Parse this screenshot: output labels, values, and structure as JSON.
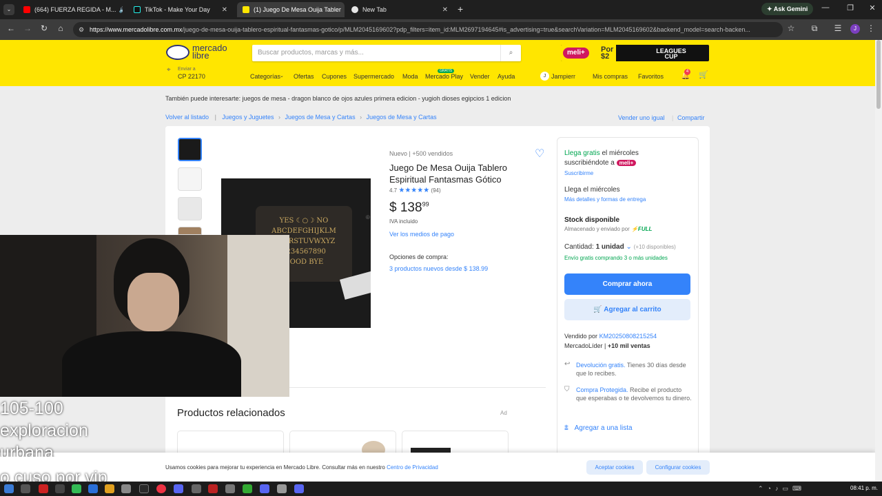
{
  "browser": {
    "tabs": [
      {
        "label": "(664) FUERZA REGIDA - M...",
        "color": "#ff0000"
      },
      {
        "label": "TikTok - Make Your Day",
        "color": "#111111"
      },
      {
        "label": "(1) Juego De Mesa Ouija Tabler",
        "color": "#ffe600"
      },
      {
        "label": "New Tab",
        "color": "#e6e6e6"
      }
    ],
    "ask_gemini": "Ask Gemini",
    "url_host": "https://www.mercadolibre.com.mx",
    "url_path": "/juego-de-mesa-ouija-tablero-espiritual-fantasmas-gotico/p/MLM2045169602?pdp_filters=item_id:MLM2697194645#is_advertising=true&searchVariation=MLM2045169602&backend_model=search-backen...",
    "profile_initial": "J"
  },
  "header": {
    "logo_line1": "mercado",
    "logo_line2": "libre",
    "search_placeholder": "Buscar productos, marcas y más...",
    "promo_badge": "meli+",
    "promo_text": "Por $2",
    "promo_leagues": "LEAGUES CUP",
    "ship_label": "Enviar a",
    "ship_cp": "CP 22170",
    "nav": [
      "Categorías",
      "Ofertas",
      "Cupones",
      "Supermercado",
      "Moda",
      "Mercado Play",
      "Vender",
      "Ayuda"
    ],
    "play_badge": "GRATIS",
    "user": "Jampierr",
    "user_initial": "J",
    "my_purchases": "Mis compras",
    "favorites": "Favoritos",
    "notif_count": "4"
  },
  "suggest": {
    "label": "También puede interesarte:",
    "items": "juegos de mesa - dragon blanco de ojos azules primera edicion - yugioh dioses egipcios 1 edicion"
  },
  "breadcrumb": {
    "back": "Volver al listado",
    "items": [
      "Juegos y Juguetes",
      "Juegos de Mesa y Cartas",
      "Juegos de Mesa y Cartas"
    ],
    "sell_same": "Vender uno igual",
    "share": "Compartir"
  },
  "product": {
    "condition": "Nuevo  |  +500 vendidos",
    "title": "Juego De Mesa Ouija Tablero Espiritual Fantasmas Gótico",
    "rating": "4.7",
    "stars": "★★★★★",
    "reviews": "(94)",
    "currency": "$",
    "price": "138",
    "cents": "99",
    "tax": "IVA incluido",
    "payment": "Ver los medios de pago",
    "options_label": "Opciones de compra:",
    "options_link": "3 productos nuevos desde $ 138.99",
    "board_text1": "YES",
    "board_text2": "NO",
    "board_row1": "OPQRSTUVWXYZ",
    "board_row2": "ABCDEFGHIJKLM",
    "board_row3": "1234567890",
    "board_row4": "GOOD BYE"
  },
  "buy": {
    "free": "Llega gratis",
    "free_rest": " el miércoles",
    "subscribe_text": "suscribiéndote a",
    "meli": "meli+",
    "subscribe_link": "Suscribirme",
    "arrive": "Llega el miércoles",
    "details": "Más detalles y formas de entrega",
    "stock": "Stock disponible",
    "stored": "Almacenado y enviado por",
    "full": "⚡FULL",
    "qty_label": "Cantidad:",
    "qty_value": "1 unidad",
    "qty_avail": "(+10 disponibles)",
    "free_ship": "Envío gratis comprando 3 o más unidades",
    "buy_now": "Comprar ahora",
    "add_cart": "Agregar al carrito",
    "sold_by": "Vendido por",
    "seller": "KM20250808215254",
    "leader": "MercadoLíder",
    "sales": "+10 mil ventas",
    "return_link": "Devolución gratis.",
    "return_text": " Tienes 30 días desde que lo recibes.",
    "protect_link": "Compra Protegida.",
    "protect_text": " Recibe el producto que esperabas o te devolvemos tu dinero.",
    "add_list": "Agregar a una lista"
  },
  "related": {
    "title": "Productos relacionados",
    "ad": "Ad"
  },
  "cookies": {
    "text": "Usamos cookies para mejorar tu experiencia en Mercado Libre. Consultar más en nuestro",
    "link": "Centro de Privacidad",
    "accept": "Aceptar cookies",
    "config": "Configurar cookies"
  },
  "overlay": {
    "line1": "105-100",
    "line2": "exploracion",
    "line3": "urbana",
    "line4": "o cuso por vip"
  },
  "taskbar": {
    "time": "08:41 p. m."
  }
}
